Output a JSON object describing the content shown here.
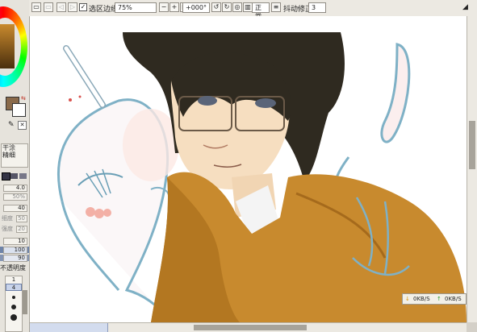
{
  "toolbar": {
    "selection_edge_label": "选区边缘",
    "selection_edge_checked": "✓",
    "zoom_value": "75%",
    "rotation_value": "+000°",
    "blend_label": "正常",
    "stabilizer_label": "抖动修正",
    "stabilizer_value": "3"
  },
  "left_panel": {
    "tool_label_line1": "干涂",
    "tool_label_line2": "精细",
    "values": [
      "4.0",
      "50%",
      "40",
      "50",
      "20",
      "10",
      "100",
      "90"
    ],
    "row_labels": [
      "",
      "",
      "",
      "细度",
      "强度",
      "",
      "",
      ""
    ],
    "opacity_label": "不透明度",
    "brush_sizes": [
      "1",
      "4"
    ]
  },
  "network": {
    "down_icon": "↓",
    "down_rate": "0KB/S",
    "up_icon": "↑",
    "up_rate": "0KB/S"
  }
}
